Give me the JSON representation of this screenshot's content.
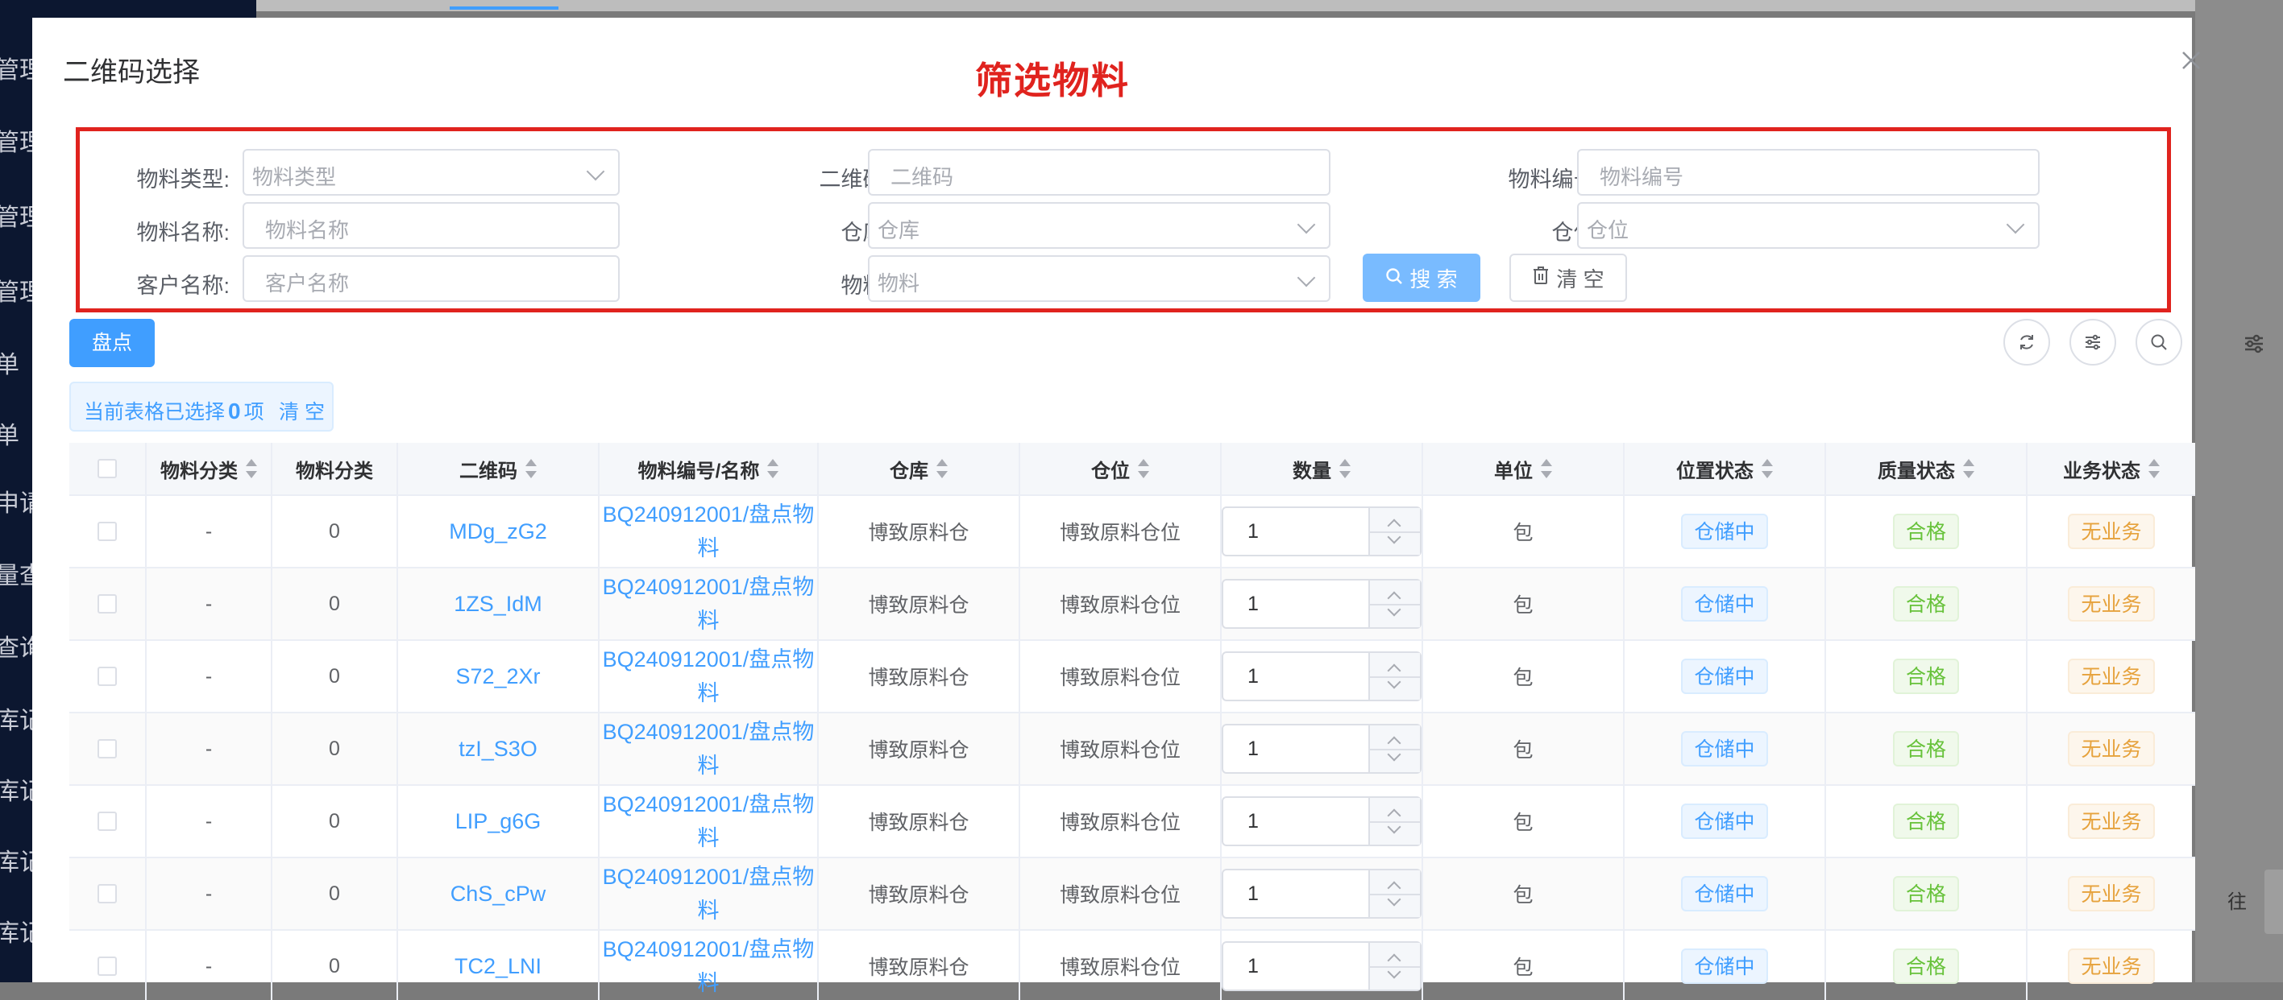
{
  "background": {
    "sidebar_items": [
      "管理",
      "管理",
      "管理",
      "管理",
      "单",
      "单",
      "申请",
      "量查",
      "查询",
      "库记",
      "库记",
      "库记",
      "库记"
    ],
    "pager_text": "往"
  },
  "dialog": {
    "title": "二维码选择",
    "annotation": "筛选物料"
  },
  "filters": {
    "material_type": {
      "label": "物料类型:",
      "placeholder": "物料类型"
    },
    "qrcode": {
      "label": "二维码:",
      "placeholder": "二维码"
    },
    "material_code": {
      "label": "物料编号:",
      "placeholder": "物料编号"
    },
    "material_name": {
      "label": "物料名称:",
      "placeholder": "物料名称"
    },
    "warehouse": {
      "label": "仓库:",
      "placeholder": "仓库"
    },
    "location": {
      "label": "仓位:",
      "placeholder": "仓位"
    },
    "customer_name": {
      "label": "客户名称:",
      "placeholder": "客户名称"
    },
    "material": {
      "label": "物料:",
      "placeholder": "物料"
    },
    "search_button": "搜 索",
    "clear_button": "清 空"
  },
  "toolbar": {
    "inventory_button": "盘点"
  },
  "selection": {
    "prefix": "当前表格已选择",
    "count": "0",
    "suffix": "项",
    "clear": "清 空"
  },
  "table": {
    "columns": [
      "物料分类",
      "物料分类",
      "二维码",
      "物料编号/名称",
      "仓库",
      "仓位",
      "数量",
      "单位",
      "位置状态",
      "质量状态",
      "业务状态"
    ],
    "rows": [
      {
        "cat1": "-",
        "cat2": "0",
        "qrcode": "MDg_zG2",
        "material_line1": "BQ240912001/盘点物",
        "material_line2": "料",
        "warehouse": "博致原料仓",
        "location": "博致原料仓位",
        "qty": "1",
        "unit": "包",
        "pos_status": "仓储中",
        "quality": "合格",
        "business": "无业务"
      },
      {
        "cat1": "-",
        "cat2": "0",
        "qrcode": "1ZS_IdM",
        "material_line1": "BQ240912001/盘点物",
        "material_line2": "料",
        "warehouse": "博致原料仓",
        "location": "博致原料仓位",
        "qty": "1",
        "unit": "包",
        "pos_status": "仓储中",
        "quality": "合格",
        "business": "无业务"
      },
      {
        "cat1": "-",
        "cat2": "0",
        "qrcode": "S72_2Xr",
        "material_line1": "BQ240912001/盘点物",
        "material_line2": "料",
        "warehouse": "博致原料仓",
        "location": "博致原料仓位",
        "qty": "1",
        "unit": "包",
        "pos_status": "仓储中",
        "quality": "合格",
        "business": "无业务"
      },
      {
        "cat1": "-",
        "cat2": "0",
        "qrcode": "tzI_S3O",
        "material_line1": "BQ240912001/盘点物",
        "material_line2": "料",
        "warehouse": "博致原料仓",
        "location": "博致原料仓位",
        "qty": "1",
        "unit": "包",
        "pos_status": "仓储中",
        "quality": "合格",
        "business": "无业务"
      },
      {
        "cat1": "-",
        "cat2": "0",
        "qrcode": "LIP_g6G",
        "material_line1": "BQ240912001/盘点物",
        "material_line2": "料",
        "warehouse": "博致原料仓",
        "location": "博致原料仓位",
        "qty": "1",
        "unit": "包",
        "pos_status": "仓储中",
        "quality": "合格",
        "business": "无业务"
      },
      {
        "cat1": "-",
        "cat2": "0",
        "qrcode": "ChS_cPw",
        "material_line1": "BQ240912001/盘点物",
        "material_line2": "料",
        "warehouse": "博致原料仓",
        "location": "博致原料仓位",
        "qty": "1",
        "unit": "包",
        "pos_status": "仓储中",
        "quality": "合格",
        "business": "无业务"
      },
      {
        "cat1": "-",
        "cat2": "0",
        "qrcode": "TC2_LNI",
        "material_line1": "BQ240912001/盘点物",
        "material_line2": "料",
        "warehouse": "博致原料仓",
        "location": "博致原料仓位",
        "qty": "1",
        "unit": "包",
        "pos_status": "仓储中",
        "quality": "合格",
        "business": "无业务"
      }
    ]
  },
  "colors": {
    "primary": "#409eff",
    "annotation_red": "#e0231e",
    "success": "#67c23a",
    "warning": "#e6a23c"
  },
  "icons": [
    "close-icon",
    "search-icon",
    "trash-icon",
    "refresh-icon",
    "filter-settings-icon",
    "search-toggle-icon",
    "chevron-down-icon",
    "sort-caret-icon"
  ]
}
